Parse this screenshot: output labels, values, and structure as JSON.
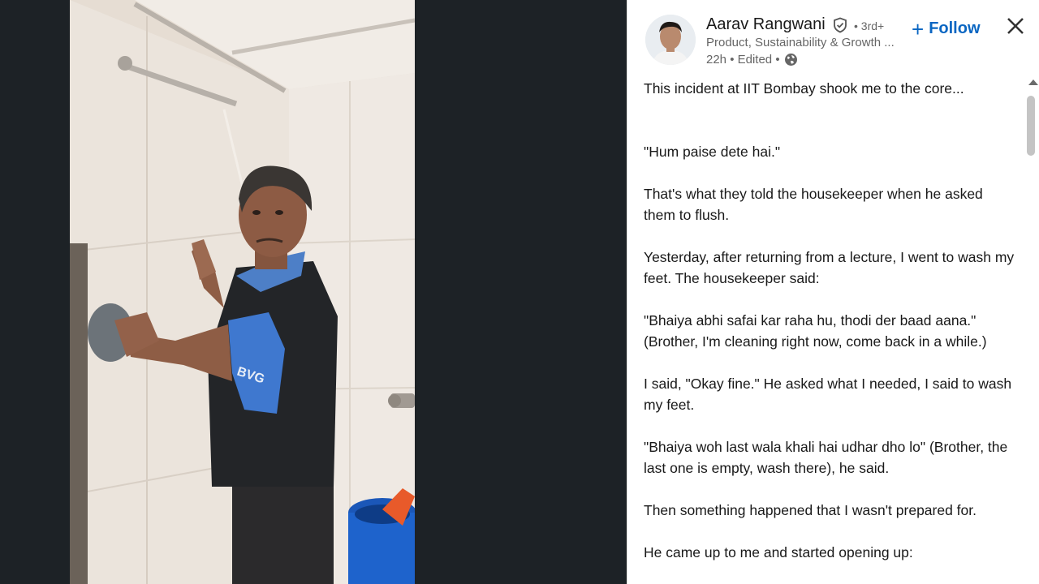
{
  "post": {
    "author": {
      "name": "Aarav Rangwani",
      "degree": "• 3rd+",
      "headline": "Product, Sustainability & Growth ...",
      "time": "22h • Edited •"
    },
    "follow_label": "Follow",
    "paragraphs": [
      "This incident at IIT Bombay shook me to the core...",
      "",
      "\"Hum paise dete hai.\"",
      "That's what they told the housekeeper when he asked them to flush.",
      "Yesterday, after returning from a lecture, I went to wash my feet. The housekeeper said:",
      "\"Bhaiya abhi safai kar raha hu, thodi der baad aana.\" (Brother, I'm cleaning right now, come back in a while.)",
      "I said, \"Okay fine.\" He asked what I needed, I said to wash my feet.",
      "\"Bhaiya woh last wala khali hai udhar dho lo\" (Brother, the last one is empty, wash there), he said.",
      "Then something happened that I wasn't prepared for.",
      "He came up to me and started opening up:"
    ]
  },
  "photo": {
    "shirt_logo": "BVG"
  },
  "icons": {
    "verified": "verified-shield-icon",
    "visibility": "globe-icon",
    "close": "close-icon",
    "plus": "plus-icon"
  },
  "colors": {
    "accent": "#0a66c2",
    "viewer_bg": "#1d2226"
  }
}
